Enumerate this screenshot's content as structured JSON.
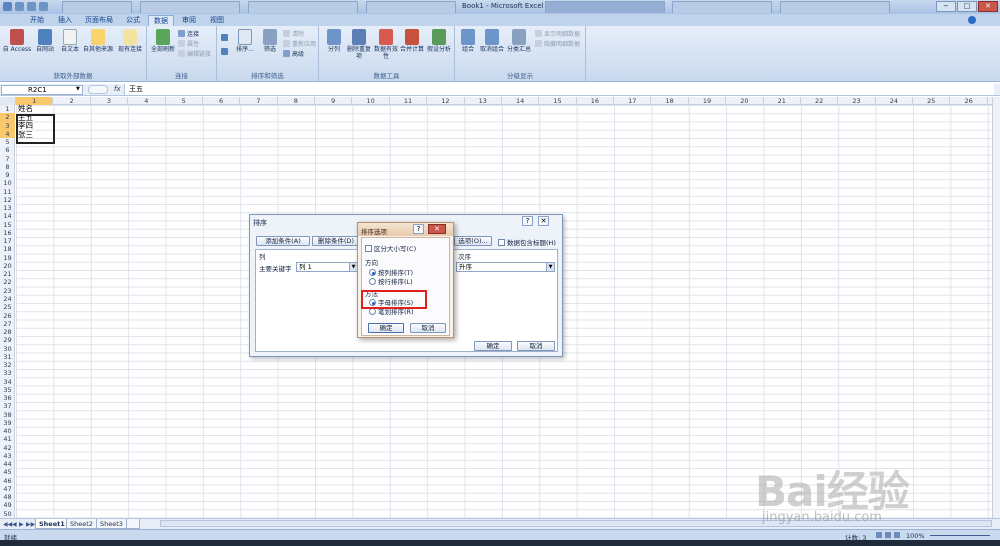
{
  "window": {
    "title": "Book1 - Microsoft Excel",
    "controls": {
      "minimize": "−",
      "maximize": "□",
      "close": "✕"
    }
  },
  "ribbon": {
    "tabs": [
      "开始",
      "插入",
      "页面布局",
      "公式",
      "数据",
      "审阅",
      "视图"
    ],
    "active_tab": "数据",
    "groups": {
      "external": {
        "title": "获取外部数据",
        "buttons": [
          "自 Access",
          "自网站",
          "自文本",
          "自其他来源",
          "现有连接"
        ]
      },
      "connections": {
        "title": "连接",
        "refresh": "全部刷新",
        "items": [
          "连接",
          "属性",
          "编辑链接"
        ]
      },
      "sortfilter": {
        "title": "排序和筛选",
        "sort": "排序...",
        "filter": "筛选",
        "items": [
          "清除",
          "重新应用",
          "高级"
        ]
      },
      "datatools": {
        "title": "数据工具",
        "buttons": [
          "分列",
          "删除重复项",
          "数据有效性",
          "合并计算",
          "假设分析"
        ]
      },
      "outline": {
        "title": "分级显示",
        "buttons": [
          "组合",
          "取消组合",
          "分类汇总"
        ],
        "items": [
          "显示明细数据",
          "隐藏明细数据"
        ]
      }
    }
  },
  "formula_bar": {
    "name_box": "R2C1",
    "fx": "fx",
    "value": "王五"
  },
  "grid": {
    "columns": [
      "1",
      "2",
      "3",
      "4",
      "5",
      "6",
      "7",
      "8",
      "9",
      "10",
      "11",
      "12",
      "13",
      "14",
      "15",
      "16",
      "17",
      "18",
      "19",
      "20",
      "21",
      "22",
      "23",
      "24",
      "25",
      "26"
    ],
    "rows": [
      "1",
      "2",
      "3",
      "4",
      "5",
      "6",
      "7",
      "8",
      "9",
      "10",
      "11",
      "12",
      "13",
      "14",
      "15",
      "16",
      "17",
      "18",
      "19",
      "20",
      "21",
      "22",
      "23",
      "24",
      "25",
      "26",
      "27",
      "28",
      "29",
      "30",
      "31",
      "32",
      "33",
      "34",
      "35",
      "36",
      "37",
      "38",
      "39",
      "40",
      "41",
      "42",
      "43",
      "44",
      "45",
      "46",
      "47",
      "48",
      "49",
      "50"
    ],
    "cells": [
      "姓名",
      "王五",
      "李四",
      "张三"
    ]
  },
  "sheets": [
    "Sheet1",
    "Sheet2",
    "Sheet3"
  ],
  "sheet_nav": [
    "◀◀",
    "◀",
    "▶",
    "▶▶"
  ],
  "status": {
    "ready": "就绪",
    "count": "计数: 3",
    "zoom": "100%"
  },
  "sort_dialog": {
    "title": "排序",
    "help": "?",
    "close": "✕",
    "add_level": "添加条件(A)",
    "delete_level": "删除条件(D)",
    "options": "选项(O)...",
    "has_headers": "数据包含标题(H)",
    "col_header": "列",
    "order_header": "次序",
    "primary_key_label": "主要关键字",
    "primary_key_value": "列 1",
    "order_value": "升序",
    "ok": "确定",
    "cancel": "取消"
  },
  "options_dialog": {
    "title": "排序选项",
    "help": "?",
    "close": "✕",
    "case_sensitive": "区分大小写(C)",
    "orientation_title": "方向",
    "by_column": "按列排序(T)",
    "by_row": "按行排序(L)",
    "method_title": "方法",
    "by_letter": "字母排序(S)",
    "by_stroke": "笔划排序(R)",
    "ok": "确定",
    "cancel": "取消"
  },
  "watermark": {
    "logo": "Bai经验",
    "url": "jingyan.baidu.com"
  },
  "colors": {
    "accent": "#15428b",
    "selection": "#f8c86b",
    "highlight": "#e0201b"
  }
}
